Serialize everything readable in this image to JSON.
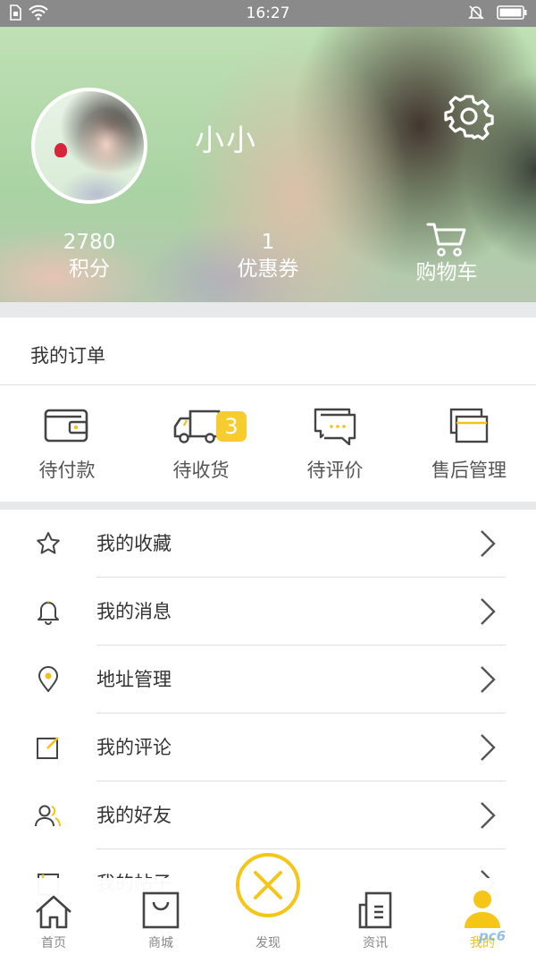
{
  "status_bar": {
    "time": "16:27"
  },
  "profile": {
    "username": "小小",
    "stats": [
      {
        "value": "2780",
        "label": "积分"
      },
      {
        "value": "1",
        "label": "优惠券"
      }
    ],
    "cart_label": "购物车"
  },
  "orders": {
    "title": "我的订单",
    "items": [
      {
        "label": "待付款",
        "icon": "wallet-icon"
      },
      {
        "label": "待收货",
        "icon": "truck-icon",
        "badge": "3"
      },
      {
        "label": "待评价",
        "icon": "chat-icon"
      },
      {
        "label": "售后管理",
        "icon": "stack-icon"
      }
    ]
  },
  "menu": [
    {
      "label": "我的收藏",
      "icon": "star-icon"
    },
    {
      "label": "我的消息",
      "icon": "bell-icon"
    },
    {
      "label": "地址管理",
      "icon": "location-icon"
    },
    {
      "label": "我的评论",
      "icon": "edit-icon"
    },
    {
      "label": "我的好友",
      "icon": "friends-icon"
    },
    {
      "label": "我的帖子",
      "icon": "post-icon"
    }
  ],
  "tabbar": {
    "tabs": [
      {
        "label": "首页",
        "icon": "home-icon"
      },
      {
        "label": "商城",
        "icon": "shopping-bag-icon"
      },
      {
        "label": "发现",
        "icon": "discover-icon"
      },
      {
        "label": "资讯",
        "icon": "news-icon"
      },
      {
        "label": "我的",
        "icon": "user-icon",
        "active": true
      }
    ]
  },
  "watermark": "pc6",
  "colors": {
    "accent": "#f5c518",
    "badge": "#f7cc2e",
    "statusbar": "#8a8a8a",
    "gap": "#e7e9ea"
  }
}
